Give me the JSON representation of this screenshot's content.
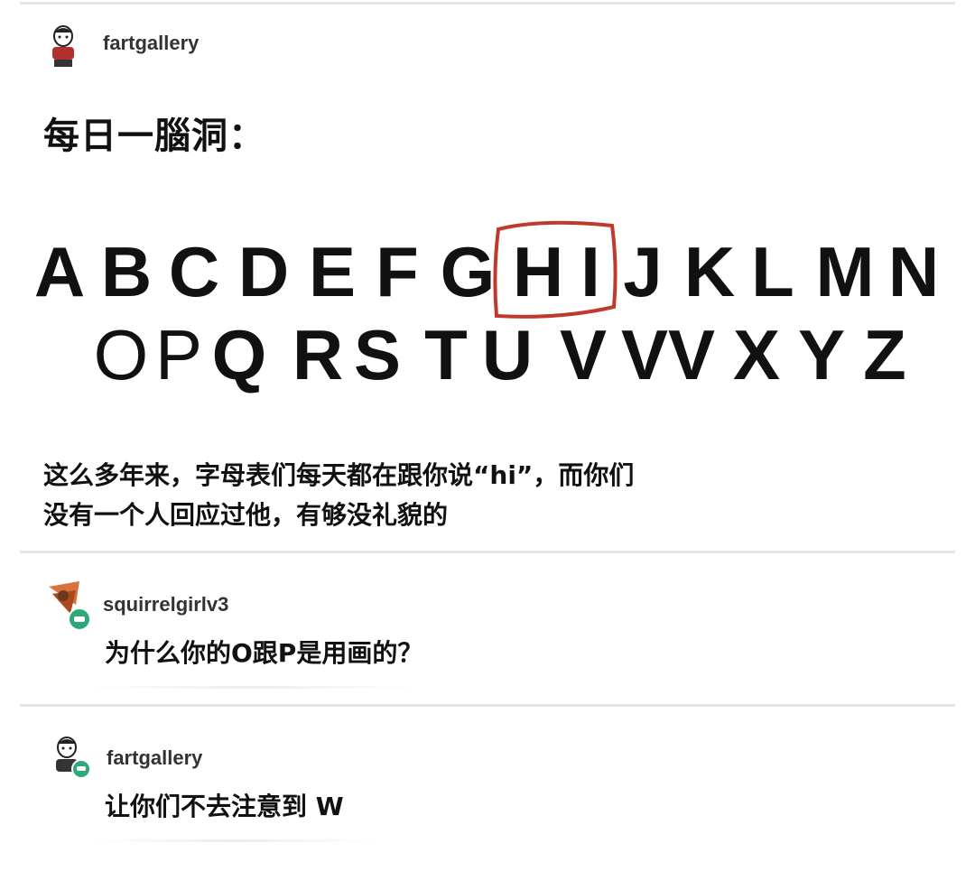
{
  "post": {
    "author": "fartgallery",
    "title": "每日一腦洞：",
    "alphabet_row1": [
      "A",
      "B",
      "C",
      "D",
      "E",
      "F",
      "G",
      "H",
      "I",
      "J",
      "K",
      "L",
      "M",
      "N"
    ],
    "alphabet_row2": [
      "O",
      "P",
      "Q",
      "R",
      "S",
      "T",
      "U",
      "V",
      "VV",
      "X",
      "Y",
      "Z"
    ],
    "body_line1": "这么多年来，字母表们每天都在跟你说“hi”，而你们",
    "body_line2": "没有一个人回应过他，有够没礼貌的"
  },
  "replies": [
    {
      "author": "squirrelgirlv3",
      "text": "为什么你的O跟P是用画的？"
    },
    {
      "author": "fartgallery",
      "text": "让你们不去注意到 W"
    }
  ],
  "colors": {
    "highlight": "#c0392b",
    "badge": "#2ea87a"
  }
}
